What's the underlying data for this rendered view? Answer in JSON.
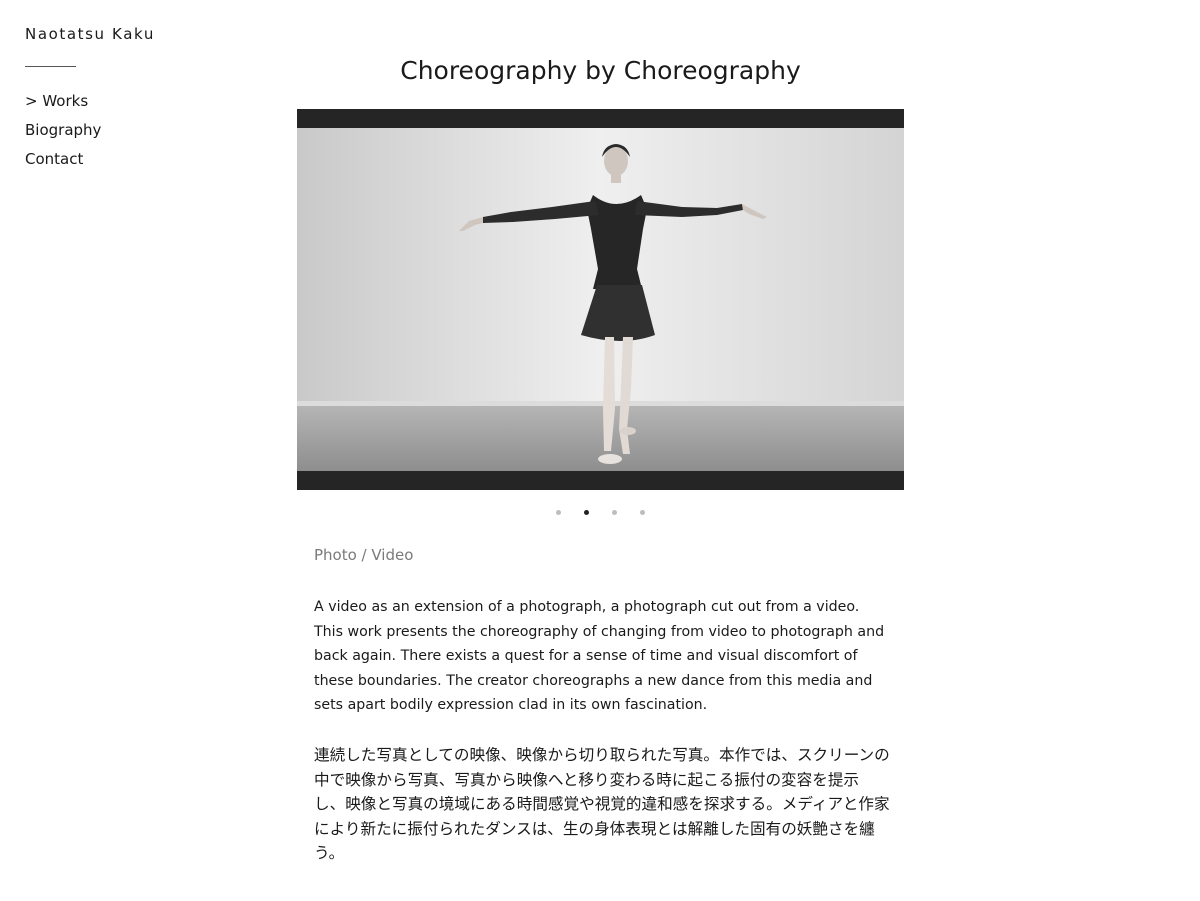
{
  "sidebar": {
    "site_name": "Naotatsu Kaku",
    "nav": [
      {
        "label": "> Works"
      },
      {
        "label": "Biography"
      },
      {
        "label": "Contact"
      }
    ]
  },
  "main": {
    "title": "Choreography by Choreography",
    "slideshow": {
      "total_slides": 4,
      "active_slide": 2
    },
    "category": "Photo / Video",
    "description_en": "A video as an extension of a photograph, a photograph cut out from a video. This work presents the choreography of changing from video to photograph and back again. There exists a quest for a sense of time and visual discomfort of these boundaries. The creator choreographs a new dance from this media and sets apart bodily expression clad in its own fascination.",
    "description_ja": "連続した写真としての映像、映像から切り取られた写真。本作では、スクリーンの中で映像から写真、写真から映像へと移り変わる時に起こる振付の変容を提示し、映像と写真の境域にある時間感覚や視覚的違和感を探求する。メディアと作家により新たに振付られたダンスは、生の身体表現とは解離した固有の妖艶さを纏う。"
  }
}
